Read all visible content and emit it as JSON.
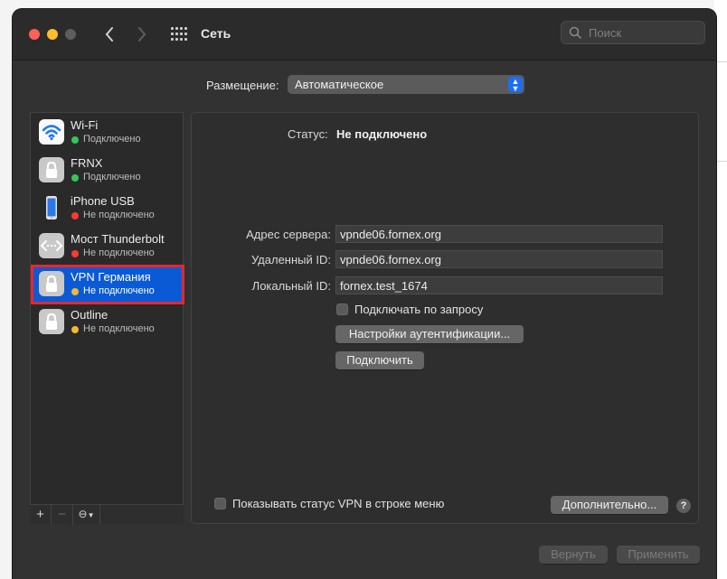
{
  "window": {
    "title": "Сеть"
  },
  "search": {
    "placeholder": "Поиск"
  },
  "location": {
    "label": "Размещение:",
    "value": "Автоматическое"
  },
  "services": [
    {
      "name": "Wi-Fi",
      "status": "Подключено",
      "status_color": "#34c759",
      "icon": "wifi-icon"
    },
    {
      "name": "FRNX",
      "status": "Подключено",
      "status_color": "#34c759",
      "icon": "lock-icon"
    },
    {
      "name": "iPhone USB",
      "status": "Не подключено",
      "status_color": "#ff3b30",
      "icon": "iphone-icon"
    },
    {
      "name": "Мост Thunderbolt",
      "status": "Не подключено",
      "status_color": "#ff3b30",
      "icon": "thunderbolt-bridge-icon"
    },
    {
      "name": "VPN Германия",
      "status": "Не подключено",
      "status_color": "#f5b82e",
      "icon": "lock-icon",
      "selected": true
    },
    {
      "name": "Outline",
      "status": "Не подключено",
      "status_color": "#f5b82e",
      "icon": "lock-icon"
    }
  ],
  "detail": {
    "status_label": "Статус:",
    "status_value": "Не подключено",
    "server_address": {
      "label": "Адрес сервера:",
      "value": "vpnde06.fornex.org"
    },
    "remote_id": {
      "label": "Удаленный ID:",
      "value": "vpnde06.fornex.org"
    },
    "local_id": {
      "label": "Локальный ID:",
      "value": "fornex.test_1674"
    },
    "connect_on_demand": {
      "label": "Подключать по запросу",
      "checked": false
    },
    "auth_settings_label": "Настройки аутентификации...",
    "connect_label": "Подключить",
    "show_vpn_status": {
      "label": "Показывать статус VPN в строке меню",
      "checked": false
    },
    "advanced_label": "Дополнительно...",
    "help_label": "?"
  },
  "sidebar_toolbar": {
    "add": "+",
    "remove": "−",
    "action": "⊖"
  },
  "footer": {
    "revert_label": "Вернуть",
    "apply_label": "Применить"
  },
  "colors": {
    "accent": "#0a5ad6",
    "highlight_border": "#e8262d"
  }
}
